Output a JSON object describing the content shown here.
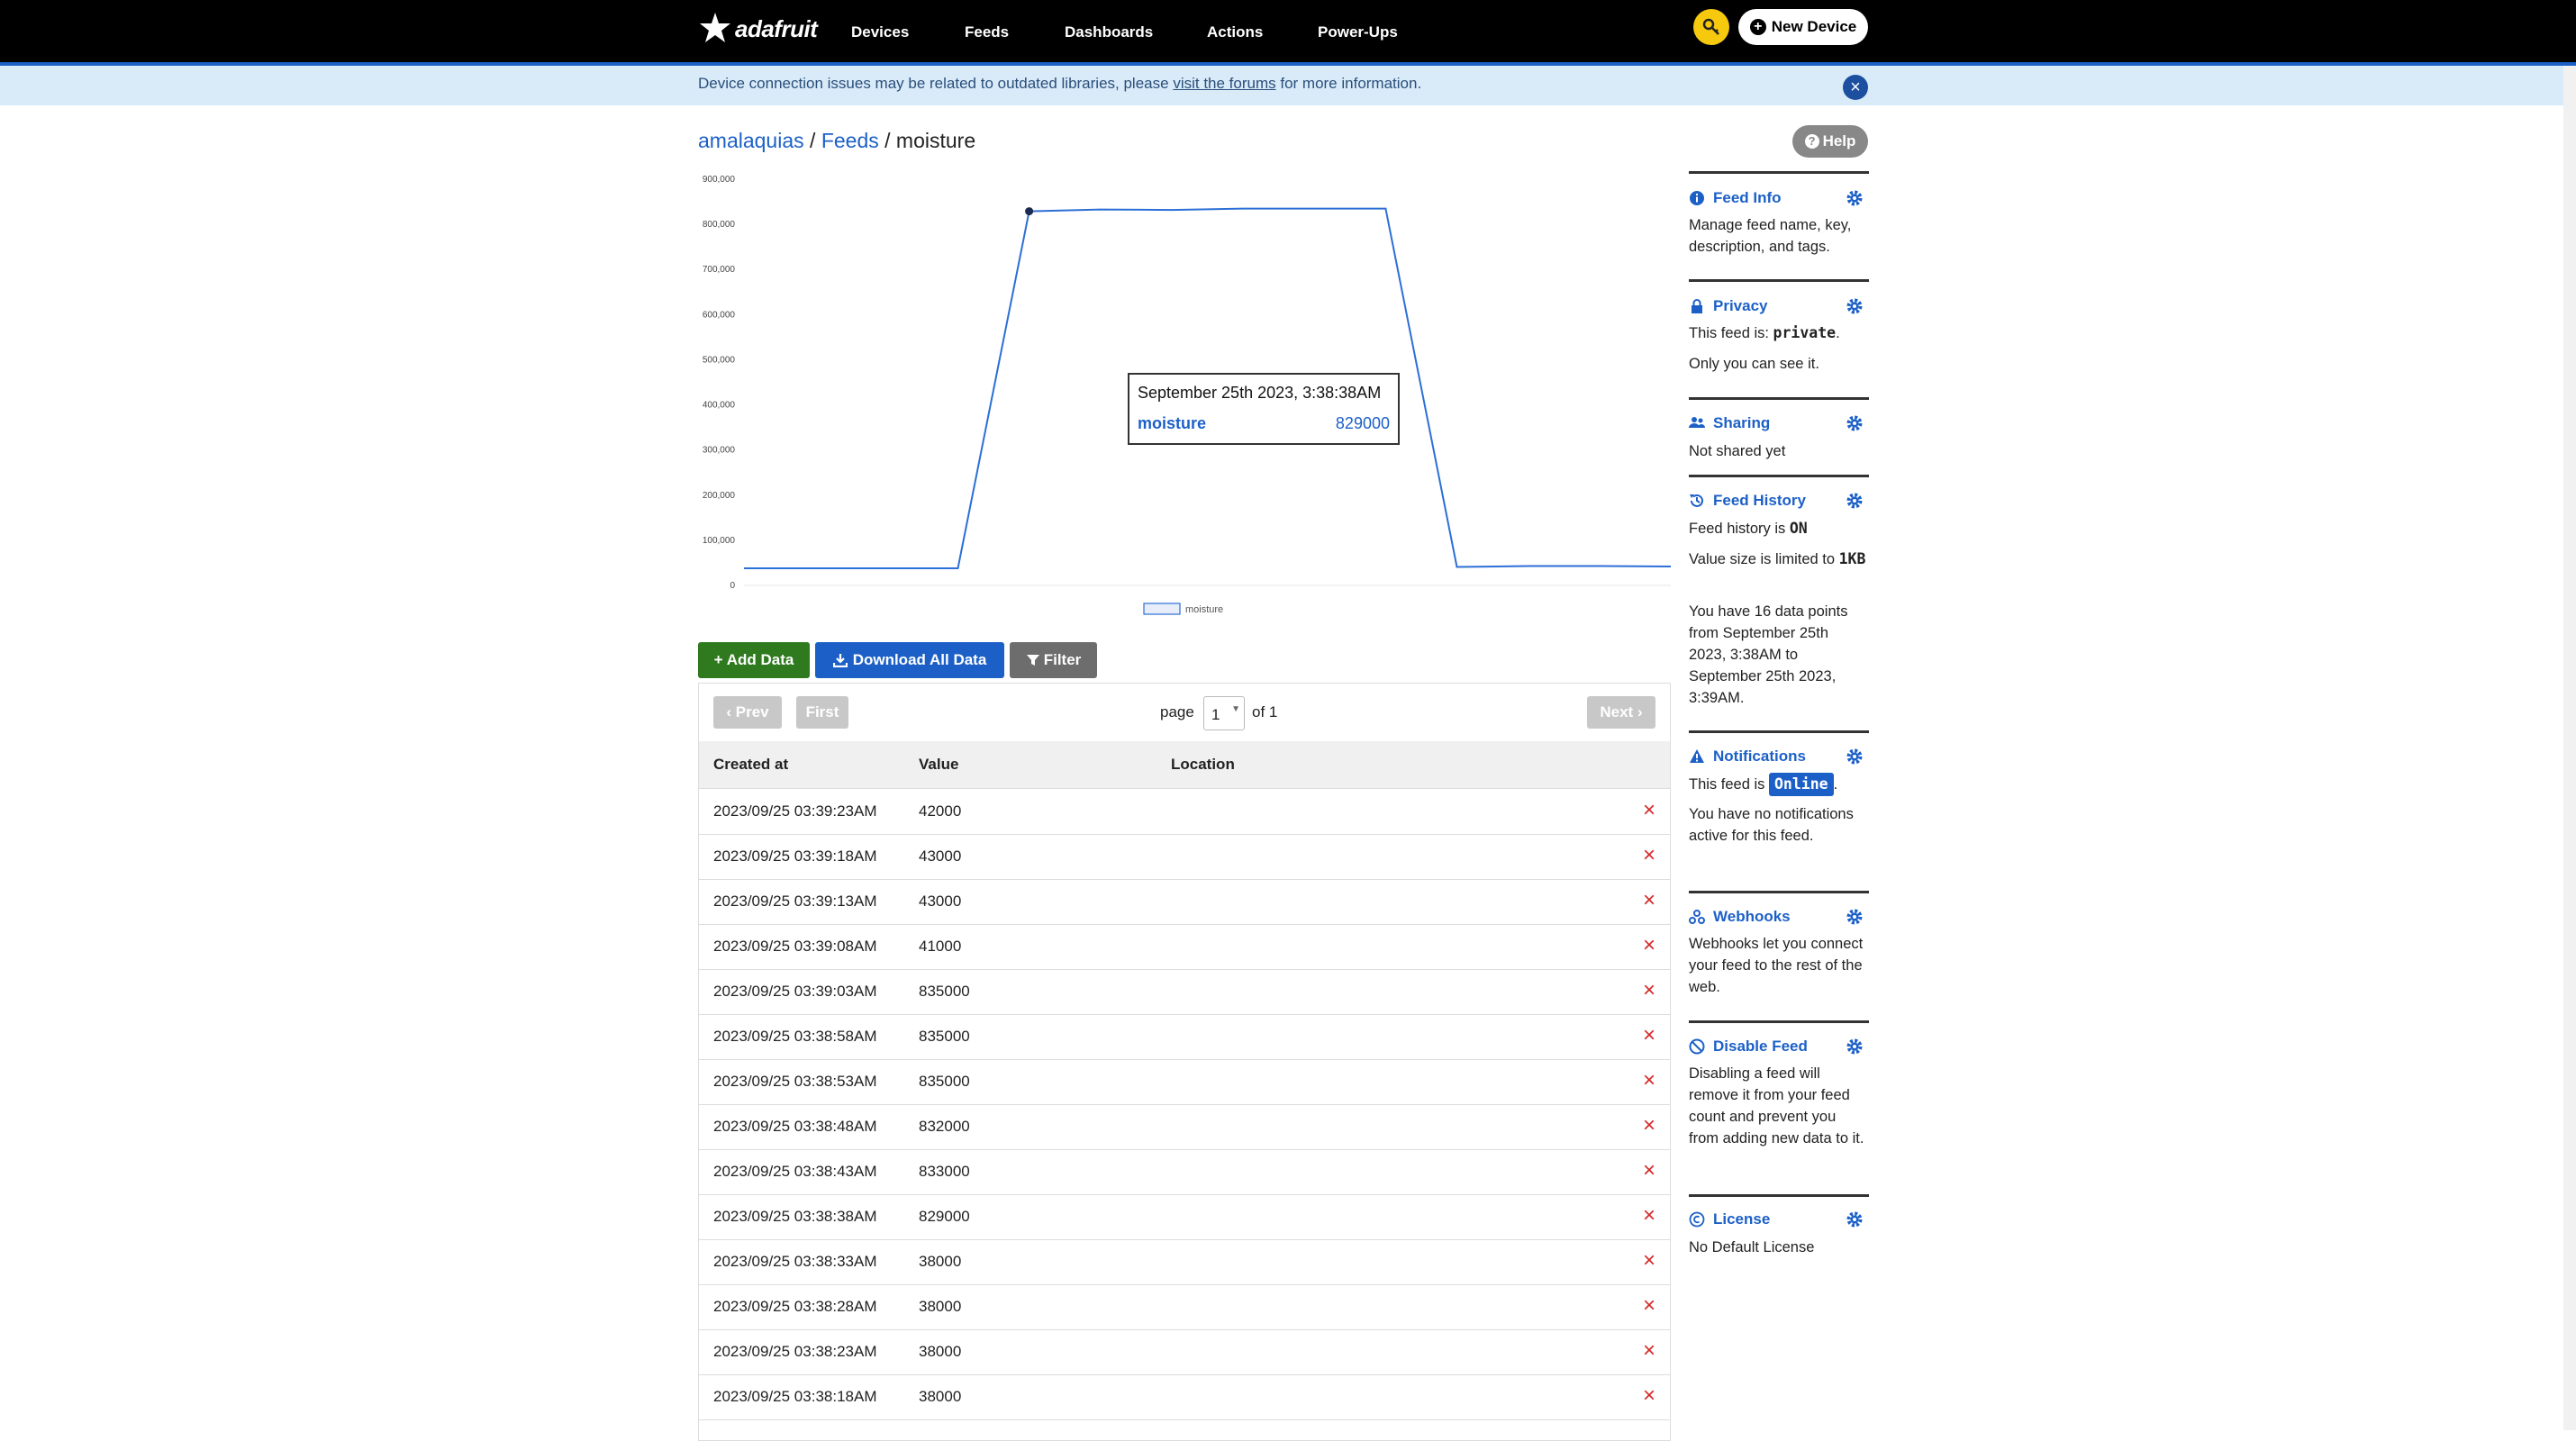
{
  "nav": {
    "brand": "adafruit",
    "links": [
      "Devices",
      "Feeds",
      "Dashboards",
      "Actions",
      "Power-Ups"
    ],
    "new_device_label": "New Device"
  },
  "alert": {
    "text_before": "Device connection issues may be related to outdated libraries, please ",
    "link_text": "visit the forums",
    "text_after": " for more information."
  },
  "breadcrumb": {
    "user": "amalaquias",
    "sep": " / ",
    "feeds": "Feeds",
    "current": "moisture"
  },
  "help_label": "Help",
  "chart_data": {
    "type": "line",
    "title": "",
    "xlabel": "",
    "ylabel": "",
    "ylim": [
      0,
      900000
    ],
    "yticks": [
      0,
      100000,
      200000,
      300000,
      400000,
      500000,
      600000,
      700000,
      800000,
      900000
    ],
    "ytick_labels": [
      "0",
      "100,000",
      "200,000",
      "300,000",
      "400,000",
      "500,000",
      "600,000",
      "700,000",
      "800,000",
      "900,000"
    ],
    "series": [
      {
        "name": "moisture",
        "color": "#2c6fd6",
        "x": [
          "2023-09-25T03:38:18",
          "2023-09-25T03:38:23",
          "2023-09-25T03:38:28",
          "2023-09-25T03:38:33",
          "2023-09-25T03:38:38",
          "2023-09-25T03:38:43",
          "2023-09-25T03:38:48",
          "2023-09-25T03:38:53",
          "2023-09-25T03:38:58",
          "2023-09-25T03:39:03",
          "2023-09-25T03:39:08",
          "2023-09-25T03:39:13",
          "2023-09-25T03:39:18",
          "2023-09-25T03:39:23"
        ],
        "values": [
          38000,
          38000,
          38000,
          38000,
          829000,
          833000,
          832000,
          835000,
          835000,
          835000,
          41000,
          43000,
          43000,
          42000
        ]
      }
    ],
    "legend": [
      "moisture"
    ],
    "legend_position": "bottom-center",
    "highlighted_point": 4,
    "tooltip": {
      "date": "September 25th 2023, 3:38:38AM",
      "series": "moisture",
      "value": "829000"
    }
  },
  "actions": {
    "add_data": "+ Add Data",
    "download": "Download All Data",
    "filter": "Filter"
  },
  "pagination": {
    "prev": "Prev",
    "first": "First",
    "page_label": "page",
    "page_value": "1",
    "of_label": "of 1",
    "next": "Next"
  },
  "table": {
    "headers": [
      "Created at",
      "Value",
      "Location"
    ],
    "rows": [
      {
        "created_at": "2023/09/25 03:39:23AM",
        "value": "42000"
      },
      {
        "created_at": "2023/09/25 03:39:18AM",
        "value": "43000"
      },
      {
        "created_at": "2023/09/25 03:39:13AM",
        "value": "43000"
      },
      {
        "created_at": "2023/09/25 03:39:08AM",
        "value": "41000"
      },
      {
        "created_at": "2023/09/25 03:39:03AM",
        "value": "835000"
      },
      {
        "created_at": "2023/09/25 03:38:58AM",
        "value": "835000"
      },
      {
        "created_at": "2023/09/25 03:38:53AM",
        "value": "835000"
      },
      {
        "created_at": "2023/09/25 03:38:48AM",
        "value": "832000"
      },
      {
        "created_at": "2023/09/25 03:38:43AM",
        "value": "833000"
      },
      {
        "created_at": "2023/09/25 03:38:38AM",
        "value": "829000"
      },
      {
        "created_at": "2023/09/25 03:38:33AM",
        "value": "38000"
      },
      {
        "created_at": "2023/09/25 03:38:28AM",
        "value": "38000"
      },
      {
        "created_at": "2023/09/25 03:38:23AM",
        "value": "38000"
      },
      {
        "created_at": "2023/09/25 03:38:18AM",
        "value": "38000"
      }
    ]
  },
  "sidebar": {
    "feed_info": {
      "title": "Feed Info",
      "text": "Manage feed name, key, description, and tags."
    },
    "privacy": {
      "title": "Privacy",
      "text_prefix": "This feed is: ",
      "state": "private",
      "text_suffix": ".",
      "note": "Only you can see it."
    },
    "sharing": {
      "title": "Sharing",
      "text": "Not shared yet"
    },
    "feed_history": {
      "title": "Feed History",
      "status_prefix": "Feed history is ",
      "status": "ON",
      "size_prefix": "Value size is limited to ",
      "size": "1KB",
      "points_text": "You have 16 data points from September 25th 2023, 3:38AM to September 25th 2023, 3:39AM."
    },
    "notifications": {
      "title": "Notifications",
      "status_prefix": "This feed is ",
      "status": "Online",
      "status_suffix": ".",
      "text": "You have no notifications active for this feed."
    },
    "webhooks": {
      "title": "Webhooks",
      "text": "Webhooks let you connect your feed to the rest of the web."
    },
    "disable_feed": {
      "title": "Disable Feed",
      "text": "Disabling a feed will remove it from your feed count and prevent you from adding new data to it."
    },
    "license": {
      "title": "License",
      "text": "No Default License"
    }
  },
  "colors": {
    "nav_bg": "#000000",
    "accent_blue": "#1c60c7",
    "alert_bg": "#d9ebf9",
    "add_green": "#2f7a1f",
    "filter_gray": "#6d6d6d",
    "delete_red": "#d62828",
    "key_yellow": "#f6c90e"
  },
  "icons": {
    "logo": "adafruit-flower-icon",
    "key": "key-icon",
    "new_device": "plus-circle-icon",
    "close": "close-icon",
    "help": "question-circle-icon",
    "download": "download-icon",
    "filter": "filter-icon",
    "delete": "delete-x-icon",
    "settings": "gear-icon"
  }
}
